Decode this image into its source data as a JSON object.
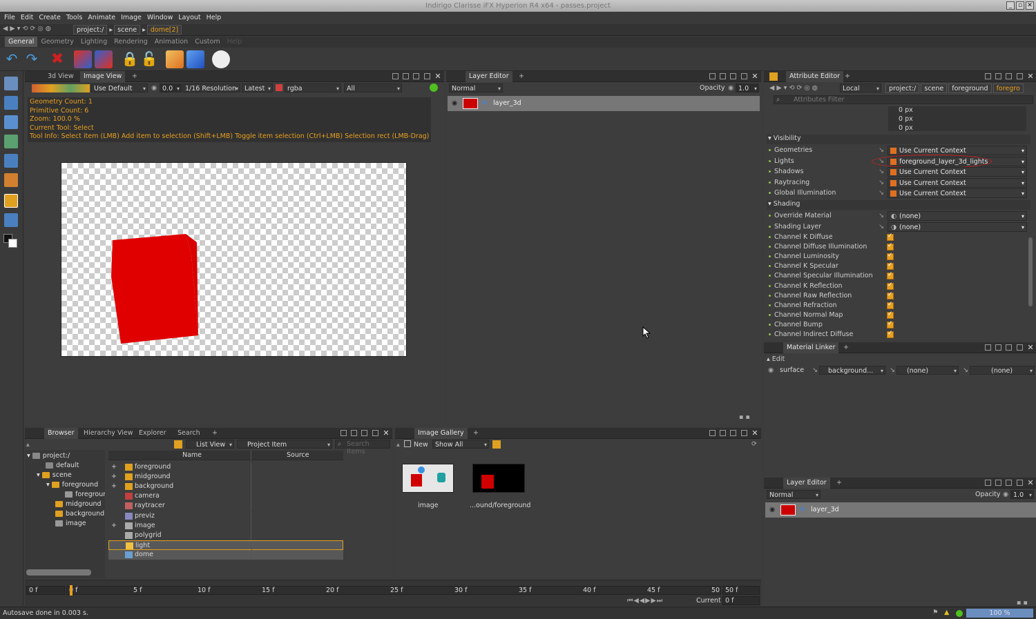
{
  "window": {
    "title": "Indirigo Clarisse iFX Hyperion R4 x64 - passes.project"
  },
  "menu": [
    "File",
    "Edit",
    "Create",
    "Tools",
    "Animate",
    "Image",
    "Window",
    "Layout",
    "Help"
  ],
  "path": {
    "seg1": "project:/",
    "seg2": "scene",
    "seg3": "dome[2]"
  },
  "tabs": [
    "General",
    "Geometry",
    "Lighting",
    "Rendering",
    "Animation",
    "Custom",
    "Help"
  ],
  "left_panel": {
    "tab_3d": "3d View",
    "tab_image": "Image View",
    "controls": {
      "display": "Use Default",
      "value": "0.0",
      "resolution": "1/16 Resolution",
      "version": "Latest",
      "channel": "rgba",
      "layer": "All"
    },
    "overlay": [
      "Geometry Count: 1",
      "Primitive Count: 6",
      "Zoom: 100.0 %",
      "Current Tool: Select",
      "Tool Info: Select item (LMB)  Add item to selection (Shift+LMB)  Toggle item selection (Ctrl+LMB)  Selection rect (LMB-Drag)"
    ],
    "colors": {
      "overlay_text": "#e8a020",
      "cube": "#e00000"
    }
  },
  "layer_editor": {
    "title": "Layer Editor",
    "mode": "Normal",
    "opacity_label": "Opacity",
    "opacity": "1.0",
    "layer": "layer_3d"
  },
  "attribute_editor": {
    "title": "Attribute Editor",
    "space": "Local",
    "path": [
      "project:/",
      "scene",
      "foreground",
      "foregro"
    ],
    "filter_placeholder": "Attributes Filter",
    "px_values": [
      "0 px",
      "0 px",
      "0 px"
    ],
    "visibility": {
      "header": "Visibility",
      "rows": [
        {
          "label": "Geometries",
          "value": "Use Current Context"
        },
        {
          "label": "Lights",
          "value": "foreground_layer_3d_lights"
        },
        {
          "label": "Shadows",
          "value": "Use Current Context"
        },
        {
          "label": "Raytracing",
          "value": "Use Current Context"
        },
        {
          "label": "Global Illumination",
          "value": "Use Current Context"
        }
      ]
    },
    "shading": {
      "header": "Shading",
      "rows": [
        {
          "label": "Override Material",
          "value": "(none)"
        },
        {
          "label": "Shading Layer",
          "value": "(none)"
        }
      ],
      "channels": [
        "Channel K Diffuse",
        "Channel Diffuse Illumination",
        "Channel Luminosity",
        "Channel K Specular",
        "Channel Specular Illumination",
        "Channel K Reflection",
        "Channel Raw Reflection",
        "Channel Refraction",
        "Channel Normal Map",
        "Channel Bump",
        "Channel Indirect Diffuse"
      ]
    }
  },
  "material_linker": {
    "title": "Material Linker",
    "edit": "Edit",
    "surface": "surface",
    "material": "background...",
    "v1": "(none)",
    "v2": "(none)"
  },
  "layer_editor2": {
    "title": "Layer Editor",
    "mode": "Normal",
    "opacity_label": "Opacity",
    "opacity": "1.0",
    "layer": "layer_3d"
  },
  "browser": {
    "tabs": [
      "Browser",
      "Hierarchy View",
      "Explorer",
      "Search"
    ],
    "view": "List View",
    "item_type": "Project Item",
    "search_placeholder": "Search Items",
    "tree": [
      "project:/",
      "default",
      "scene",
      "foreground",
      "foregroun",
      "midground",
      "background",
      "image"
    ],
    "col_name": "Name",
    "col_source": "Source",
    "items": [
      "foreground",
      "midground",
      "background",
      "camera",
      "raytracer",
      "previz",
      "image",
      "polygrid",
      "light",
      "dome"
    ]
  },
  "gallery": {
    "title": "Image Gallery",
    "new": "New",
    "show": "Show All",
    "thumbs": [
      "image",
      "...ound/foreground"
    ]
  },
  "timeline": {
    "start": "0 f",
    "end": "50 f",
    "marks": [
      "0 f",
      "5 f",
      "10 f",
      "15 f",
      "20 f",
      "25 f",
      "30 f",
      "35 f",
      "40 f",
      "45 f",
      "50 f"
    ],
    "current_label": "Current",
    "current": "0 f"
  },
  "status": {
    "text": "Autosave done in 0.003 s.",
    "zoom": "100 %"
  }
}
